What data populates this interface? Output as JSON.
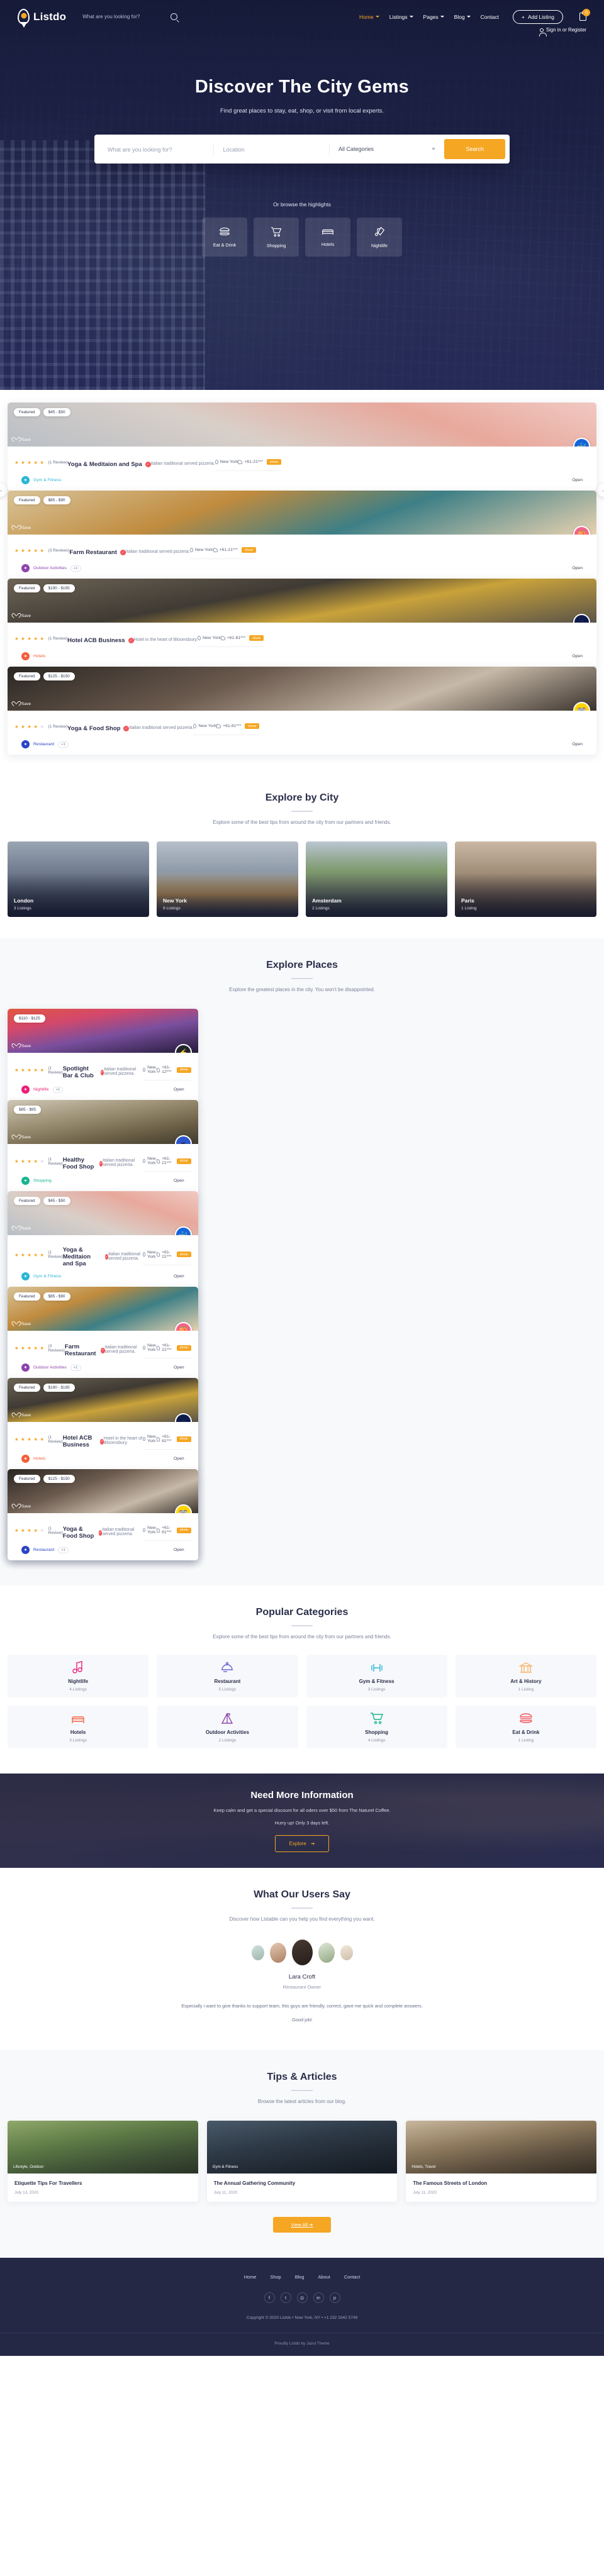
{
  "header": {
    "logo_text": "Listdo",
    "search_placeholder": "What are you looking for?",
    "nav": [
      {
        "label": "Home",
        "has_caret": true,
        "active": true
      },
      {
        "label": "Listings",
        "has_caret": true,
        "active": false
      },
      {
        "label": "Pages",
        "has_caret": true,
        "active": false
      },
      {
        "label": "Blog",
        "has_caret": true,
        "active": false
      },
      {
        "label": "Contact",
        "has_caret": false,
        "active": false
      }
    ],
    "add_listing": "Add Listing",
    "cart_count": "0",
    "sign_in": "Sign in or Register"
  },
  "hero": {
    "title": "Discover The City Gems",
    "subtitle": "Find great places to stay, eat, shop, or visit from local experts.",
    "search_placeholder": "What are you looking for?",
    "location_placeholder": "Location",
    "category_value": "All Categories",
    "search_button": "Search",
    "browse_label": "Or browse the highlights",
    "highlights": [
      {
        "label": "Eat & Drink",
        "icon": "burger-icon"
      },
      {
        "label": "Shopping",
        "icon": "cart-icon"
      },
      {
        "label": "Hotels",
        "icon": "bed-icon"
      },
      {
        "label": "Nightlife",
        "icon": "music-guitar-icon"
      }
    ]
  },
  "featured": [
    {
      "featured_label": "Featured",
      "price": "$45 - $50",
      "save": "Save",
      "stars": 5,
      "reviews": "(1 Review)",
      "title": "Yoga & Meditaion and Spa",
      "desc": "Italian traditional served pizzeria.",
      "location": "New York",
      "phone": "+61-21***",
      "show": "show",
      "category": "Gym & Fitness",
      "cat_color": "#2ab7d4",
      "extra": "",
      "status": "Open",
      "avatar": "🐳",
      "avatar_bg": "#1565d8",
      "img": "spa"
    },
    {
      "featured_label": "Featured",
      "price": "$85 - $90",
      "save": "Save",
      "stars": 4.5,
      "reviews": "(3 Reviews)",
      "title": "Farm Restaurant",
      "desc": "Italian traditional served pizzeria.",
      "location": "New York",
      "phone": "+61-21***",
      "show": "show",
      "category": "Outdoor Activities",
      "cat_color": "#8e44ad",
      "extra": "+1",
      "status": "Open",
      "avatar": "🍑",
      "avatar_bg": "#f5628b",
      "img": "bar"
    },
    {
      "featured_label": "Featured",
      "price": "$190 - $195",
      "save": "Save",
      "stars": 4.5,
      "reviews": "(1 Review)",
      "title": "Hotel ACB Business",
      "desc": "Hotel in the heart of Bloomsbury.",
      "location": "New York",
      "phone": "+61-81***",
      "show": "show",
      "category": "Hotels",
      "cat_color": "#f2603c",
      "extra": "",
      "status": "Open",
      "avatar": "⚛",
      "avatar_bg": "#0d1b4c",
      "img": "cafe"
    },
    {
      "featured_label": "Featured",
      "price": "$125 - $150",
      "save": "Save",
      "stars": 4,
      "reviews": "(1 Review)",
      "title": "Yoga & Food Shop",
      "desc": "Italian traditional served pizzeria.",
      "location": "New York",
      "phone": "+61-81***",
      "show": "show",
      "category": "Restaurant",
      "cat_color": "#2b44c7",
      "extra": "+1",
      "status": "Open",
      "avatar": "🐨",
      "avatar_bg": "#ffd400",
      "img": "party"
    }
  ],
  "cities_section": {
    "title": "Explore by City",
    "subtitle": "Explore some of the best tips from around the city from our partners and friends.",
    "items": [
      {
        "name": "London",
        "listings": "3 Listings",
        "img": "london"
      },
      {
        "name": "New York",
        "listings": "9 Listings",
        "img": "newyork"
      },
      {
        "name": "Amsterdam",
        "listings": "2 Listings",
        "img": "amsterdam"
      },
      {
        "name": "Paris",
        "listings": "1 Listing",
        "img": "paris"
      }
    ]
  },
  "places_section": {
    "title": "Explore Places",
    "subtitle": "Explore the greatest places in the city. You won't be disappointed.",
    "items": [
      {
        "featured_label": "",
        "price": "$110 - $125",
        "save": "Save",
        "stars": 4.5,
        "reviews": "(1 Review)",
        "title": "Spotlight Bar & Club",
        "desc": "Italian traditional served pizzeria.",
        "location": "New York",
        "phone": "+61-12***",
        "show": "show",
        "category": "Nightlife",
        "cat_color": "#ed1e79",
        "extra": "+1",
        "status": "Open",
        "avatar": "⚡",
        "avatar_bg": "#22252f",
        "img": "concert"
      },
      {
        "featured_label": "",
        "price": "$85 - $95",
        "save": "Save",
        "stars": 4,
        "reviews": "(1 Review)",
        "title": "Healthy Food Shop",
        "desc": "Italian traditional served pizzeria.",
        "location": "New York",
        "phone": "+61-21***",
        "show": "show",
        "category": "Shopping",
        "cat_color": "#18b48e",
        "extra": "",
        "status": "Open",
        "avatar": "♥",
        "avatar_bg": "#2d55c9",
        "img": "couple"
      },
      {
        "featured_label": "Featured",
        "price": "$45 - $50",
        "save": "Save",
        "stars": 5,
        "reviews": "(1 Review)",
        "title": "Yoga & Meditaion and Spa",
        "desc": "Italian traditional served pizzeria.",
        "location": "New York",
        "phone": "+61-21***",
        "show": "show",
        "category": "Gym & Fitness",
        "cat_color": "#2ab7d4",
        "extra": "",
        "status": "Open",
        "avatar": "🐳",
        "avatar_bg": "#1565d8",
        "img": "spa"
      },
      {
        "featured_label": "Featured",
        "price": "$85 - $90",
        "save": "Save",
        "stars": 4.5,
        "reviews": "(3 Reviews)",
        "title": "Farm Restaurant",
        "desc": "Italian traditional served pizzeria.",
        "location": "New York",
        "phone": "+61-21***",
        "show": "show",
        "category": "Outdoor Activities",
        "cat_color": "#8e44ad",
        "extra": "+1",
        "status": "Open",
        "avatar": "🍑",
        "avatar_bg": "#f5628b",
        "img": "bar"
      },
      {
        "featured_label": "Featured",
        "price": "$190 - $195",
        "save": "Save",
        "stars": 4.5,
        "reviews": "(1 Review)",
        "title": "Hotel ACB Business",
        "desc": "Hotel in the heart of Bloomsbury.",
        "location": "New York",
        "phone": "+61-81***",
        "show": "show",
        "category": "Hotels",
        "cat_color": "#f2603c",
        "extra": "",
        "status": "Open",
        "avatar": "⚛",
        "avatar_bg": "#0d1b4c",
        "img": "cafe"
      },
      {
        "featured_label": "Featured",
        "price": "$125 - $150",
        "save": "Save",
        "stars": 4,
        "reviews": "(1 Review)",
        "title": "Yoga & Food Shop",
        "desc": "Italian traditional served pizzeria.",
        "location": "New York",
        "phone": "+61-81***",
        "show": "show",
        "category": "Restaurant",
        "cat_color": "#2b44c7",
        "extra": "+1",
        "status": "Open",
        "avatar": "🐨",
        "avatar_bg": "#ffd400",
        "img": "party"
      }
    ]
  },
  "categories_section": {
    "title": "Popular Categories",
    "subtitle": "Explore some of the best tips from around the city from our partners and friends.",
    "items": [
      {
        "name": "Nightlife",
        "listings": "4 Listings",
        "icon": "music-note-icon",
        "color": "#ed1e79"
      },
      {
        "name": "Restaurant",
        "listings": "5 Listings",
        "icon": "food-cloche-icon",
        "color": "#6c63d8"
      },
      {
        "name": "Gym & Fitness",
        "listings": "3 Listings",
        "icon": "dumbbell-icon",
        "color": "#2ab7d4"
      },
      {
        "name": "Art & History",
        "listings": "1 Listing",
        "icon": "museum-icon",
        "color": "#f7b267"
      },
      {
        "name": "Hotels",
        "listings": "3 Listings",
        "icon": "bed-icon",
        "color": "#f2603c"
      },
      {
        "name": "Outdoor Activities",
        "listings": "2 Listings",
        "icon": "tent-icon",
        "color": "#8e44ad"
      },
      {
        "name": "Shopping",
        "listings": "4 Listings",
        "icon": "shopping-cart-icon",
        "color": "#18b48e"
      },
      {
        "name": "Eat & Drink",
        "listings": "1 Listing",
        "icon": "burger-icon",
        "color": "#f2545b"
      }
    ]
  },
  "cta": {
    "title": "Need More Information",
    "line1": "Keep calm and get a special discount for all oders over $50 from The Naturel Coffee.",
    "line2": "Hurry up! Only 3 days left.",
    "button": "Explore"
  },
  "testimonials": {
    "title": "What Our Users Say",
    "subtitle": "Discover how Listable can you help you find everything you want.",
    "name": "Lara Croft",
    "role": "Restaurant Owner",
    "quote": "Especially i want to give thanks to support team, this guys are friendly, correct, gave me quick and complete answers.",
    "quote2": "Good job!"
  },
  "blog": {
    "title": "Tips & Articles",
    "subtitle": "Browse the latest articles from our blog.",
    "posts": [
      {
        "tag": "Lifestyle, Outdoor",
        "title": "Etiquette Tips For Travellers",
        "date": "July 13, 2020",
        "img": "hikers"
      },
      {
        "tag": "Gym & Fitness",
        "title": "The Annual Gathering Community",
        "date": "July 11, 2020",
        "img": "gym"
      },
      {
        "tag": "Hotels, Travel",
        "title": "The Famous Streets of London",
        "date": "July 11, 2020",
        "img": "couple-travel"
      }
    ],
    "view_all": "View All"
  },
  "footer": {
    "nav": [
      "Home",
      "Shop",
      "Blog",
      "About",
      "Contact"
    ],
    "social": [
      {
        "name": "facebook-icon",
        "glyph": "f"
      },
      {
        "name": "twitter-icon",
        "glyph": "t"
      },
      {
        "name": "instagram-icon",
        "glyph": "◎"
      },
      {
        "name": "linkedin-icon",
        "glyph": "in"
      },
      {
        "name": "pinterest-icon",
        "glyph": "p"
      }
    ],
    "copyright": "Copyright © 2020 Listdo   •   Now York, NY   •   +1 232 3342 5749",
    "credit": "Proudly Listdo by Jazul Theme"
  }
}
